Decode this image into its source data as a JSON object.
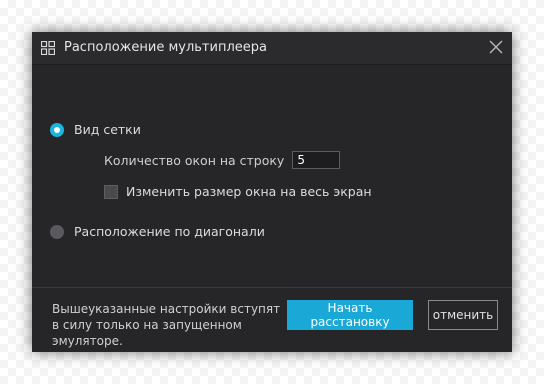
{
  "dialog": {
    "title": "Расположение мультиплеера",
    "title_icon": "grid-layout-icon",
    "close_icon": "close-icon"
  },
  "options": {
    "grid": {
      "label": "Вид сетки",
      "selected": true,
      "rows_label": "Количество окон на строку",
      "rows_value": "5",
      "fullscreen_label": "Изменить размер окна на весь экран",
      "fullscreen_checked": false
    },
    "diagonal": {
      "label": "Расположение по диагонали",
      "selected": false
    }
  },
  "footer": {
    "note": "Вышеуказанные настройки вступят в силу только на запущенном эмуляторе.",
    "start_label": "Начать расстановку",
    "cancel_label": "отменить"
  },
  "colors": {
    "accent": "#1aa8d6",
    "background": "#262629"
  }
}
